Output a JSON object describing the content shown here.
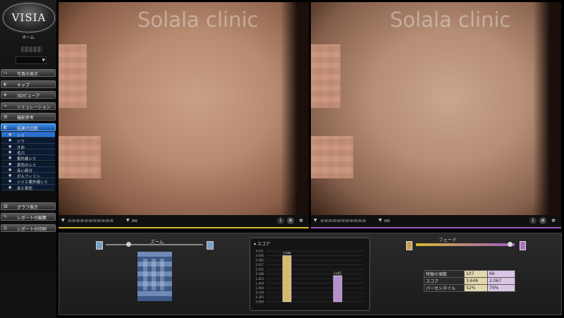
{
  "sidebar": {
    "logo": "VISIA",
    "home": "ホーム",
    "nav": [
      {
        "label": "写真の表示",
        "icon": "photo-icon"
      },
      {
        "label": "キャプ",
        "icon": "camera-icon"
      },
      {
        "label": "3Dビューア",
        "icon": "3d-icon"
      },
      {
        "label": "シミュレーション",
        "icon": "simulation-icon"
      },
      {
        "label": "撮影参考",
        "icon": "reference-icon"
      },
      {
        "label": "結果の比較",
        "icon": "compare-icon"
      }
    ],
    "sub_items": [
      "シミ",
      "シワ",
      "きめ",
      "毛穴",
      "紫外線シミ",
      "茶色のシミ",
      "赤い部分",
      "ポルフィリン",
      "シミと紫外線シミ",
      "赤と茶色"
    ],
    "nav_bottom": [
      {
        "label": "グラフ表示",
        "icon": "graph-icon"
      },
      {
        "label": "レポートの編集",
        "icon": "report-edit-icon"
      },
      {
        "label": "レポートの印刷",
        "icon": "print-icon"
      }
    ]
  },
  "photos": {
    "watermark": "Solala clinic"
  },
  "zoom": {
    "label": "ズーム",
    "value": 0.23
  },
  "score": {
    "title": "スコア",
    "y_ticks": [
      "4.011",
      "3.646",
      "3.282",
      "2.917",
      "2.552",
      "2.188",
      "1.823",
      "1.459",
      "1.094",
      "0.729",
      "0.365",
      "0.000"
    ]
  },
  "chart_data": {
    "type": "bar",
    "title": "スコア",
    "categories": [
      "left",
      "right"
    ],
    "values": [
      3.646,
      2.067
    ],
    "ylim": [
      0,
      4.011
    ],
    "colors": [
      "#d6b870",
      "#b58fd0"
    ]
  },
  "fade": {
    "label": "フェード",
    "value": 0.95
  },
  "stats": {
    "rows": [
      {
        "label": "特徴の個数",
        "left": "107",
        "right": "66"
      },
      {
        "label": "スコア",
        "left": "3.646",
        "right": "2.067"
      },
      {
        "label": "パーセンタイル",
        "left": "52%",
        "right": "79%"
      }
    ]
  },
  "colors": {
    "left_accent": "#d8b830",
    "right_accent": "#9a5cc0",
    "active_nav": "#2a6fd0"
  }
}
